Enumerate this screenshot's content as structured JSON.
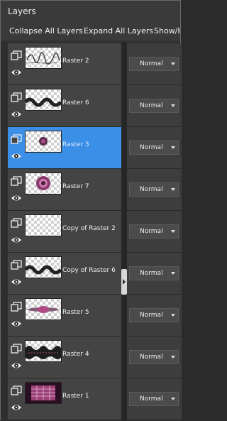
{
  "panel": {
    "title": "Layers"
  },
  "toolbar": {
    "collapse_label": "Collapse All Layers",
    "expand_label": "Expand All Layers",
    "show_label": "Show/H"
  },
  "layers": [
    {
      "name": "Raster 2",
      "blend": "Normal",
      "selected": false,
      "thumb": "text"
    },
    {
      "name": "Raster 6",
      "blend": "Normal",
      "selected": false,
      "thumb": "wave"
    },
    {
      "name": "Raster 3",
      "blend": "Normal",
      "selected": true,
      "thumb": "dot"
    },
    {
      "name": "Raster 7",
      "blend": "Normal",
      "selected": false,
      "thumb": "flower"
    },
    {
      "name": "Copy of Raster 2",
      "blend": "Normal",
      "selected": false,
      "thumb": "empty"
    },
    {
      "name": "Copy of Raster 6",
      "blend": "Normal",
      "selected": false,
      "thumb": "wave"
    },
    {
      "name": "Raster 5",
      "blend": "Normal",
      "selected": false,
      "thumb": "streak"
    },
    {
      "name": "Raster 4",
      "blend": "Normal",
      "selected": false,
      "thumb": "band"
    },
    {
      "name": "Raster 1",
      "blend": "Normal",
      "selected": false,
      "thumb": "pink"
    }
  ],
  "colors": {
    "selected": "#3c8fe6",
    "pink": "#b04a86"
  }
}
